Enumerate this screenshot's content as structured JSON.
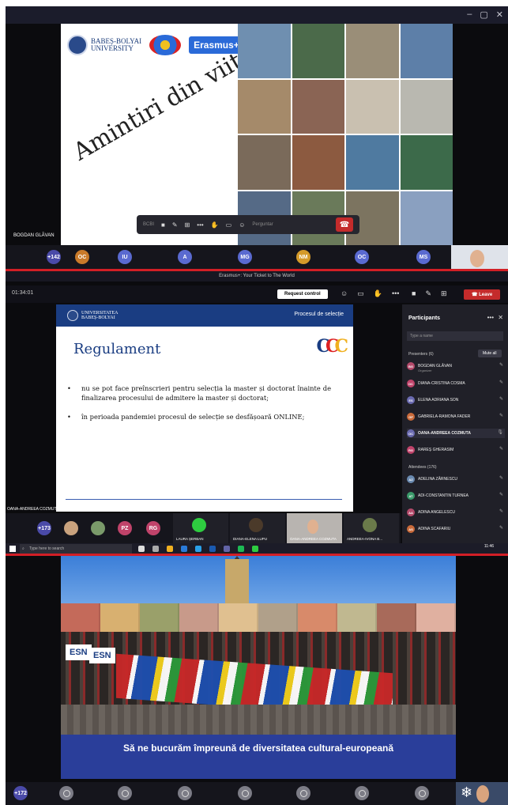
{
  "panel1": {
    "logos": {
      "ubb_line1": "BABEȘ-BOLYAI",
      "ubb_line2": "UNIVERSITY",
      "erasmus": "Erasmus+"
    },
    "slide_title": "Amintiri din viitor",
    "presenter_name": "BOGDAN GLĂVAN",
    "callbar": {
      "label": "BCBI",
      "hint": "Perguntar"
    },
    "participants": [
      {
        "initials": "+142",
        "color": "#4a4aa8"
      },
      {
        "initials": "OC",
        "color": "#c97a2a"
      },
      {
        "initials": "IU",
        "color": "#5a6ad0"
      },
      {
        "initials": "A",
        "color": "#5a6ad0"
      },
      {
        "initials": "MG",
        "color": "#5a6ad0"
      },
      {
        "initials": "NM",
        "color": "#d49a2a"
      },
      {
        "initials": "OC",
        "color": "#5a6ad0"
      },
      {
        "initials": "MS",
        "color": "#5a6ad0"
      }
    ]
  },
  "panel2": {
    "window_title": "Erasmus+: Your Ticket to The World",
    "timer": "01:34:01",
    "request_control": "Request control",
    "leave": "Leave",
    "slide": {
      "header_logo_line1": "UNIVERSITATEA",
      "header_logo_line2": "BABEȘ-BOLYAI",
      "header_right": "Procesul de selecție",
      "title": "Regulament",
      "bullets": [
        "nu se pot face preînscrieri pentru selecția la master și doctorat înainte de finalizarea procesului de admitere la master și doctorat;",
        "în perioada pandemiei procesul de selecție se desfășoară ONLINE;"
      ]
    },
    "presenter_name": "OANA-ANDREEA COZMUTA",
    "participants_panel": {
      "title": "Participants",
      "search_placeholder": "Type a name",
      "presenters_label": "Presenters (6)",
      "mute_all": "Mute all",
      "presenters": [
        {
          "initials": "BG",
          "name": "BOGDAN GLĂVAN",
          "role": "Organizer",
          "color": "#b34a6a"
        },
        {
          "initials": "DC",
          "name": "DIANA-CRISTINA COSMA",
          "role": "",
          "color": "#c0436a"
        },
        {
          "initials": "ES",
          "name": "ELENA ADRIANA SON",
          "role": "",
          "color": "#6a6ab0"
        },
        {
          "initials": "GF",
          "name": "GABRIELA-RAMONA FADER",
          "role": "",
          "color": "#c96a3a"
        },
        {
          "initials": "OC",
          "name": "OANA-ANDREEA COZMUTA",
          "role": "",
          "color": "#6a6ab0"
        },
        {
          "initials": "RG",
          "name": "RAREȘ GHERASIM",
          "role": "",
          "color": "#c0436a"
        }
      ],
      "attendees_label": "Attendees (176)",
      "attendees": [
        {
          "initials": "AZ",
          "name": "ADELINA ZĂRNESCU",
          "color": "#6a8ab0"
        },
        {
          "initials": "AT",
          "name": "ADI-CONSTANTIN TURNEA",
          "color": "#3a9a6a"
        },
        {
          "initials": "AA",
          "name": "ADINA ANGELESCU",
          "color": "#b34a6a"
        },
        {
          "initials": "AS",
          "name": "ADINA SCAFARIU",
          "color": "#c96a3a"
        }
      ]
    },
    "strip": {
      "overflow": "+173",
      "avatars": [
        {
          "initials": "PZ",
          "color": "#c0436a"
        },
        {
          "initials": "RG",
          "color": "#c0436a"
        }
      ],
      "tiles": [
        "LAURA ȘERBAN",
        "DIANA-ELENA LUPU",
        "OANA-ANDREEA COZMUTA",
        "ANDREEA-IVONA B..."
      ]
    },
    "taskbar": {
      "search": "Type here to search",
      "time": "11:46"
    }
  },
  "panel3": {
    "esn": [
      "ESN",
      "ESN"
    ],
    "caption": "Să ne bucurăm împreună de diversitatea cultural-europeană",
    "overflow": "+172"
  }
}
